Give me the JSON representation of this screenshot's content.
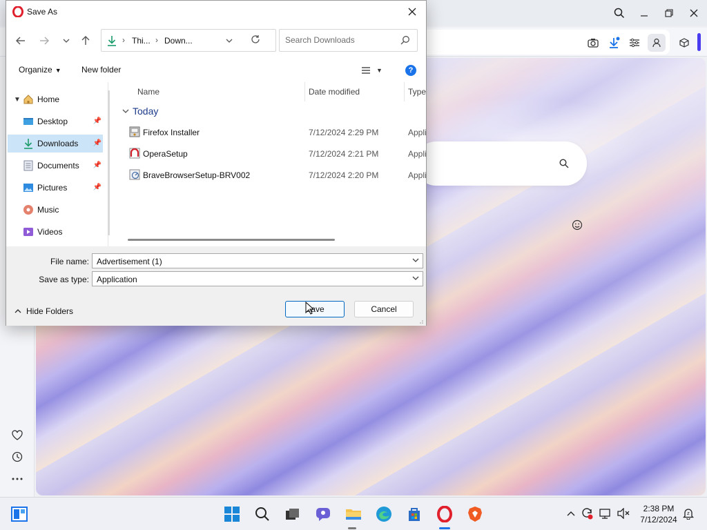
{
  "dialog": {
    "title": "Save As",
    "breadcrumb": [
      "Thi...",
      "Down..."
    ],
    "search_placeholder": "Search Downloads",
    "commands": {
      "organize": "Organize",
      "new_folder": "New folder"
    },
    "nav_items": [
      {
        "label": "Home",
        "icon": "home-icon",
        "pinned": false
      },
      {
        "label": "Desktop",
        "icon": "desktop-icon",
        "pinned": true
      },
      {
        "label": "Downloads",
        "icon": "download-icon",
        "pinned": true
      },
      {
        "label": "Documents",
        "icon": "documents-icon",
        "pinned": true
      },
      {
        "label": "Pictures",
        "icon": "pictures-icon",
        "pinned": true
      },
      {
        "label": "Music",
        "icon": "music-icon",
        "pinned": false
      },
      {
        "label": "Videos",
        "icon": "videos-icon",
        "pinned": false
      }
    ],
    "columns": {
      "name": "Name",
      "date": "Date modified",
      "type": "Type"
    },
    "group": "Today",
    "files": [
      {
        "name": "Firefox Installer",
        "date": "7/12/2024 2:29 PM",
        "type": "Appli",
        "icon": "installer-icon"
      },
      {
        "name": "OperaSetup",
        "date": "7/12/2024 2:21 PM",
        "type": "Appli",
        "icon": "opera-setup-icon"
      },
      {
        "name": "BraveBrowserSetup-BRV002",
        "date": "7/12/2024 2:20 PM",
        "type": "Appli",
        "icon": "brave-setup-icon"
      }
    ],
    "file_name_label": "File name:",
    "file_name_value": "Advertisement (1)",
    "save_type_label": "Save as type:",
    "save_type_value": "Application",
    "hide_folders": "Hide Folders",
    "save_button": "Save",
    "cancel_button": "Cancel"
  },
  "taskbar": {
    "time": "2:38 PM",
    "date": "7/12/2024"
  },
  "colors": {
    "accent": "#0067c0",
    "selection": "#cce4f7",
    "opera_red": "#e0202c",
    "help_blue": "#1a73e8"
  }
}
